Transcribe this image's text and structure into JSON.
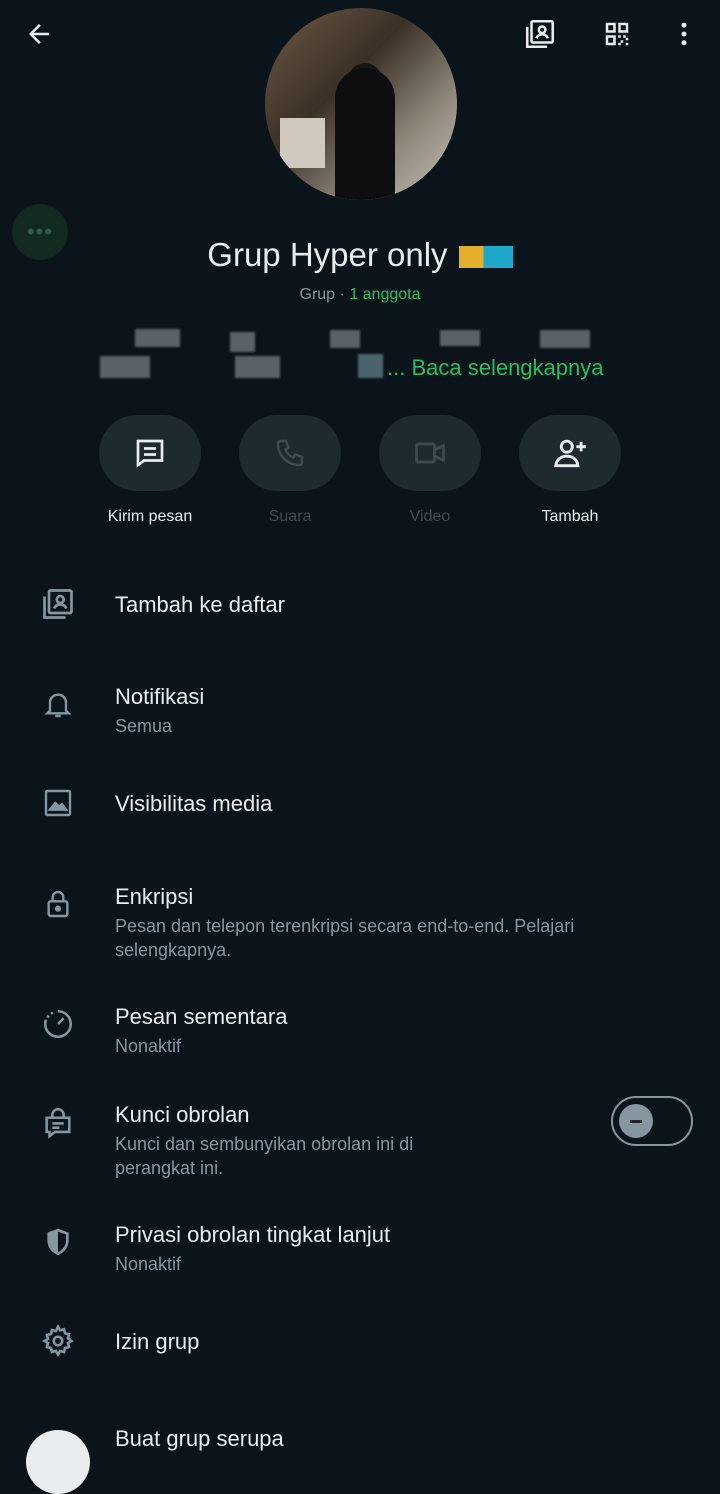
{
  "header": {
    "back_icon": "arrow-left-icon",
    "list_icon": "contact-list-icon",
    "qr_icon": "qr-code-icon",
    "menu_icon": "more-vertical-icon"
  },
  "profile": {
    "name": "Grup Hyper only",
    "type": "Grup",
    "separator": "·",
    "members": "1 anggota",
    "read_more": "... Baca selengkapnya"
  },
  "actions": [
    {
      "label": "Kirim pesan",
      "icon": "message-icon",
      "enabled": true
    },
    {
      "label": "Suara",
      "icon": "phone-icon",
      "enabled": false
    },
    {
      "label": "Video",
      "icon": "video-icon",
      "enabled": false
    },
    {
      "label": "Tambah",
      "icon": "add-person-icon",
      "enabled": true
    }
  ],
  "menu": {
    "add_to_list": {
      "title": "Tambah ke daftar"
    },
    "notifications": {
      "title": "Notifikasi",
      "subtitle": "Semua"
    },
    "media_visibility": {
      "title": "Visibilitas media"
    },
    "encryption": {
      "title": "Enkripsi",
      "subtitle": "Pesan dan telepon terenkripsi secara end-to-end. Pelajari selengkapnya."
    },
    "disappearing": {
      "title": "Pesan sementara",
      "subtitle": "Nonaktif"
    },
    "chat_lock": {
      "title": "Kunci obrolan",
      "subtitle": "Kunci dan sembunyikan obrolan ini di perangkat ini.",
      "toggle_on": false
    },
    "advanced_privacy": {
      "title": "Privasi obrolan tingkat lanjut",
      "subtitle": "Nonaktif"
    },
    "group_permissions": {
      "title": "Izin grup"
    },
    "similar_group": {
      "title": "Buat grup serupa"
    }
  },
  "colors": {
    "background": "#0b141a",
    "accent": "#21c063",
    "muted": "#8696a0",
    "button_bg": "#1f2a30"
  }
}
